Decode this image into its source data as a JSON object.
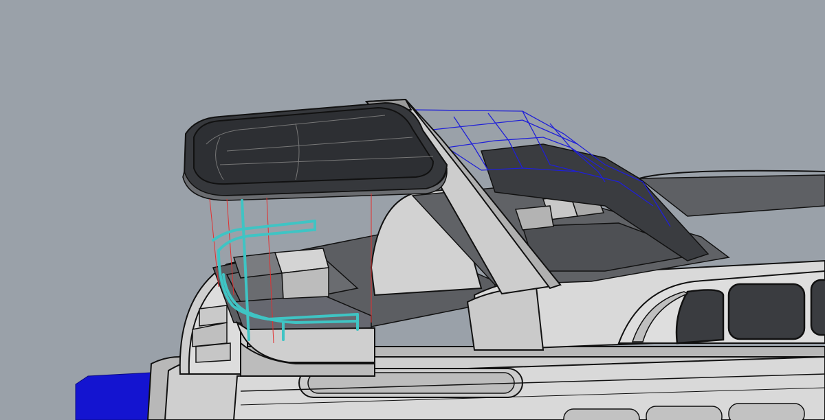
{
  "viewport": {
    "background": "#9aa1a9",
    "scene": "shaded-3d-yacht-model",
    "colors": {
      "hull": "#d4d4d4",
      "hull_shadow": "#a9a9a9",
      "canopy": "#3a3c40",
      "canopy_top": "#2e3034",
      "deck": "#5a5c60",
      "glass": "#3c3e42",
      "railing": "#3fc4c4",
      "wireframe": "#1f1fd8",
      "construction_lines": "#e23030",
      "blue_object": "#1414d0",
      "edges": "#111111"
    }
  }
}
